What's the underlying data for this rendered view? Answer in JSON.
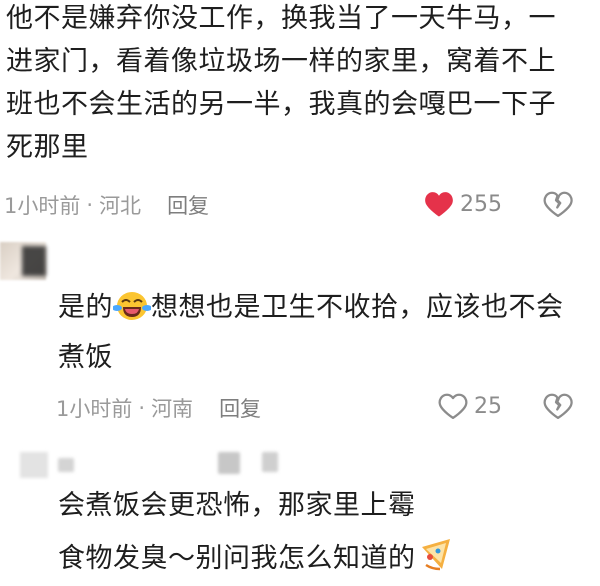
{
  "comments": [
    {
      "text_lines": [
        "他不是嫌弃你没工作，换我当了一天牛马，一",
        "进家门，看着像垃圾场一样的家里，窝着不上",
        "班也不会生活的另一半，我真的会嘎巴一下子",
        "死那里"
      ],
      "time": "1小时前",
      "separator": "·",
      "location": "河北",
      "reply_label": "回复",
      "likes": "255",
      "liked": true,
      "like_color": "#e5324a"
    },
    {
      "text_before_emoji": "是的",
      "emoji": "crying-laughing-emoji",
      "text_after_emoji": "想想也是卫生不收拾，应该也不会",
      "text_line2": "煮饭",
      "time": "1小时前",
      "separator": "·",
      "location": "河南",
      "reply_label": "回复",
      "likes": "25",
      "liked": false
    },
    {
      "text_line1": "会煮饭会更恐怖，那家里上霉",
      "text_line2": "食物发臭～别问我怎么知道的",
      "emoji": "tada-emoji"
    }
  ]
}
